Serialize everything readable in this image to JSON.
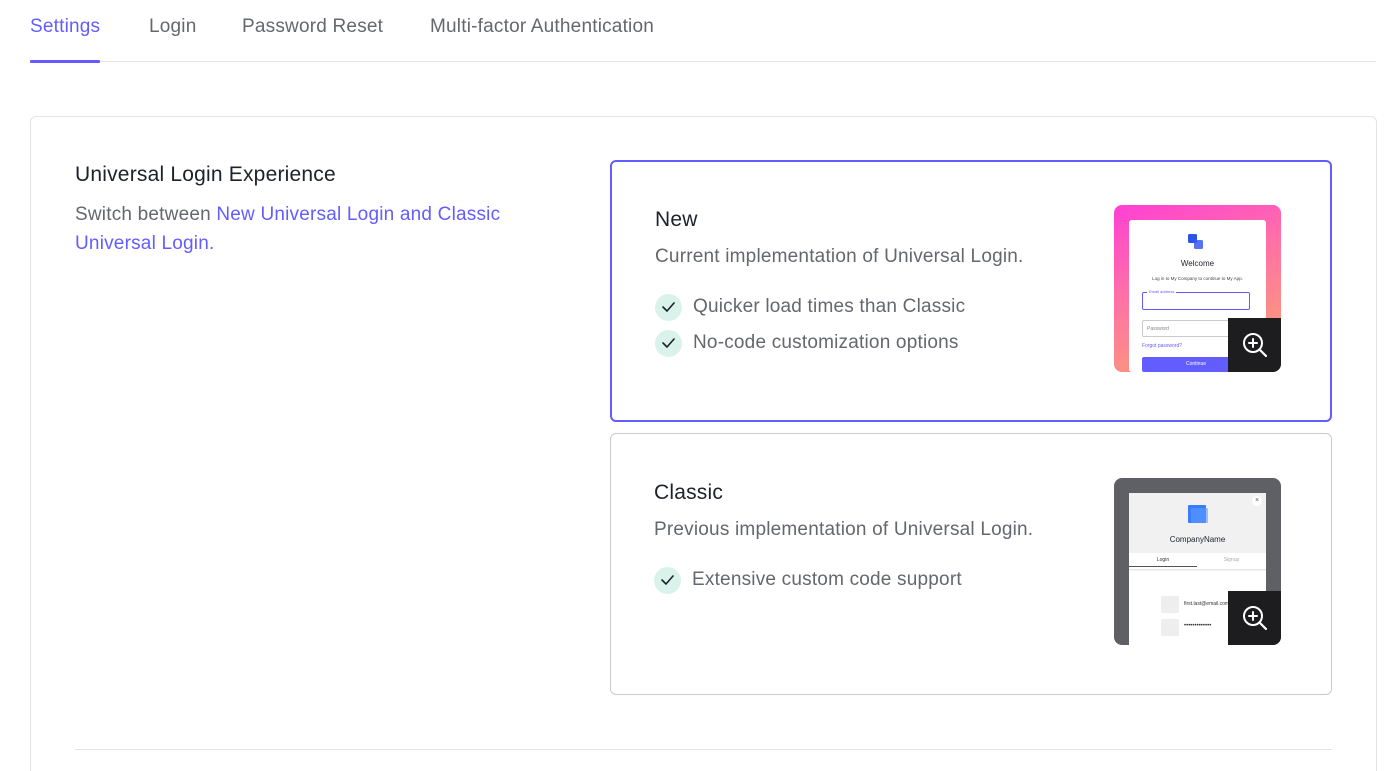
{
  "tabs": [
    {
      "label": "Settings",
      "active": true
    },
    {
      "label": "Login",
      "active": false
    },
    {
      "label": "Password Reset",
      "active": false
    },
    {
      "label": "Multi-factor Authentication",
      "active": false
    }
  ],
  "section": {
    "title": "Universal Login Experience",
    "desc_prefix": "Switch between ",
    "desc_link": "New Universal Login and Classic Universal Login."
  },
  "options": {
    "new": {
      "title": "New",
      "subtitle": "Current implementation of Universal Login.",
      "features": [
        "Quicker load times than Classic",
        "No-code customization options"
      ],
      "preview": {
        "heading": "Welcome",
        "text": "Log in to My Company to continue to My App.",
        "email_label": "Email address",
        "password_placeholder": "Password",
        "forgot": "Forgot password?",
        "button": "Continue"
      }
    },
    "classic": {
      "title": "Classic",
      "subtitle": "Previous implementation of Universal Login.",
      "features": [
        "Extensive custom code support"
      ],
      "preview": {
        "company": "CompanyName",
        "tab_login": "Login",
        "tab_signup": "Signup",
        "email": "first.last@email.com",
        "password": "•••••••••••••",
        "close": "×"
      }
    }
  },
  "colors": {
    "accent": "#635dff",
    "check_bg": "#d9f3ea",
    "check_color": "#1e212a"
  },
  "icons": {
    "check": "check-icon",
    "zoom": "zoom-in-icon",
    "logo": "company-logo-icon"
  }
}
